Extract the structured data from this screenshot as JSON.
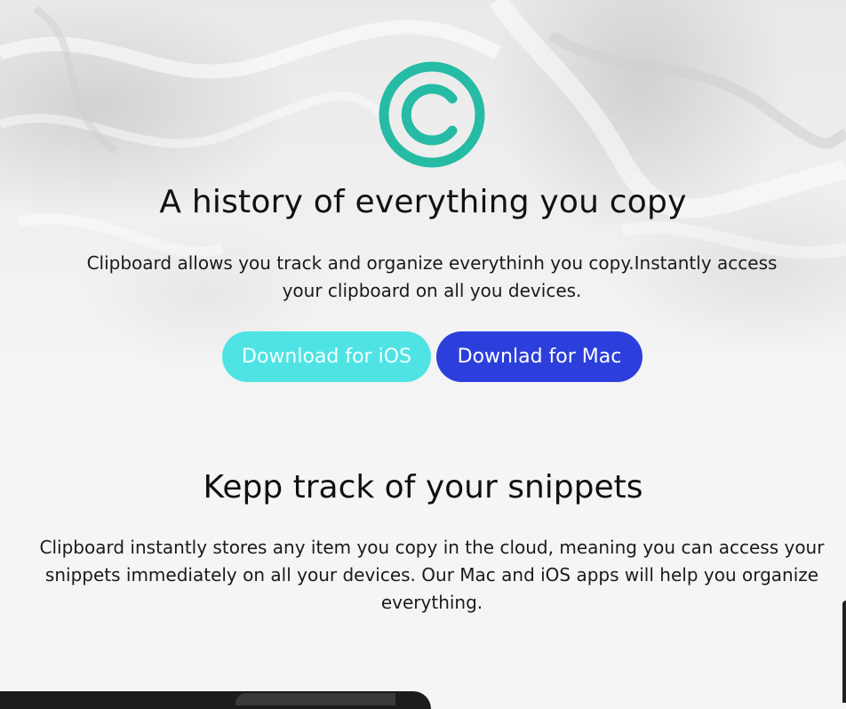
{
  "hero": {
    "title": "A history of everything you copy",
    "description": "Clipboard allows you track and organize everythinh you copy.Instantly access your clipboard on all you devices.",
    "ios_button": "Download for iOS",
    "mac_button": "Downlad for Mac"
  },
  "features": {
    "title": "Kepp track of your snippets",
    "description": "Clipboard instantly stores any item you copy in the cloud, meaning you can access your snippets immediately on all your devices. Our Mac and iOS apps will help you organize everything."
  },
  "logo": {
    "icon": "copyright-c-logo-icon",
    "color": "#26bba4"
  },
  "colors": {
    "ios_button": "#4fe3e4",
    "mac_button": "#2c3fdc",
    "text": "#121212",
    "background": "#f5f5f5"
  }
}
